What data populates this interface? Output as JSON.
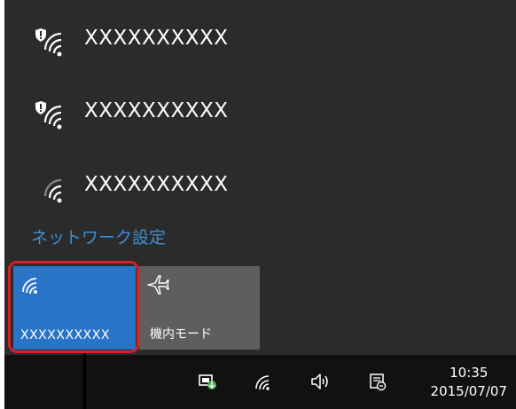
{
  "networks": [
    {
      "name": "XXXXXXXXXX",
      "secured": true
    },
    {
      "name": "XXXXXXXXXX",
      "secured": true
    },
    {
      "name": "XXXXXXXXXX",
      "secured": false
    }
  ],
  "network_settings_link": "ネットワーク設定",
  "tiles": {
    "wifi": {
      "label": "XXXXXXXXXX",
      "icon": "wifi-icon",
      "active": true
    },
    "airplane": {
      "label": "機内モード",
      "icon": "airplane-icon",
      "active": false
    }
  },
  "taskbar": {
    "time": "10:35",
    "date": "2015/07/07",
    "icons": [
      "device-safely-remove-icon",
      "wifi-icon",
      "volume-icon",
      "notifications-icon"
    ]
  },
  "colors": {
    "flyout_bg": "#2b2b2b",
    "accent": "#2a74c8",
    "link": "#3c8fd6",
    "tile_inactive": "#5e5e5e",
    "highlight": "#d7202a",
    "taskbar_bg": "#111111"
  }
}
